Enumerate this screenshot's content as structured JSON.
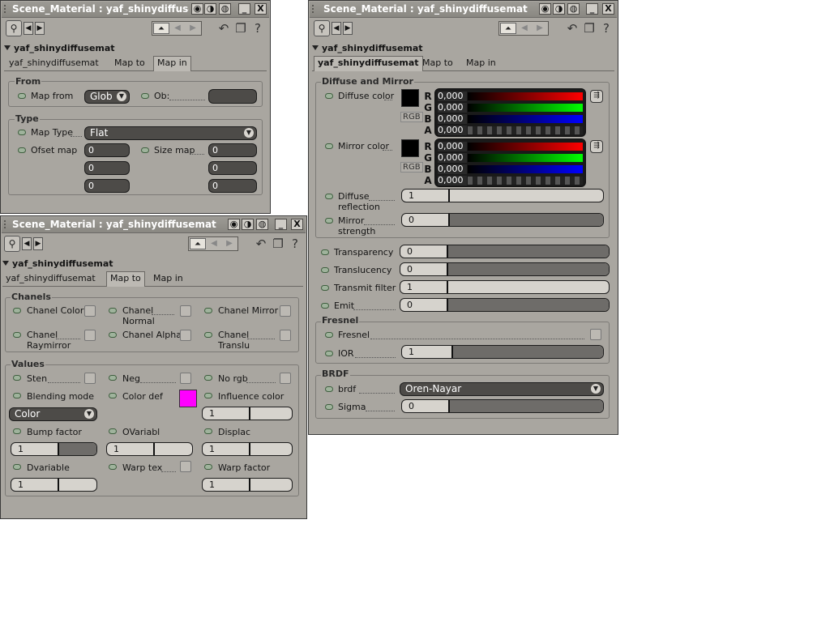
{
  "colors": {
    "accent_magenta": "#ff00ff",
    "window_bg": "#a9a6a0"
  },
  "title_buttons": {
    "min": "_",
    "close": "X"
  },
  "window_a": {
    "title": "Scene_Material : yaf_shinydiffusem...",
    "material": "yaf_shinydiffusemat",
    "tabs": [
      "yaf_shinydiffusemat",
      "Map to",
      "Map in"
    ],
    "active_tab": "Map in",
    "from": {
      "title": "From",
      "map_from_label": "Map from",
      "map_from_value": "Glob",
      "ob_label": "Ob:"
    },
    "type": {
      "title": "Type",
      "map_type_label": "Map Type",
      "map_type_value": "Flat",
      "ofset_label": "Ofset map",
      "size_label": "Size map",
      "ofset_values": [
        "0",
        "0",
        "0"
      ],
      "size_values": [
        "0",
        "0",
        "0"
      ]
    }
  },
  "window_b": {
    "title": "Scene_Material : yaf_shinydiffusemat",
    "material": "yaf_shinydiffusemat",
    "tabs": [
      "yaf_shinydiffusemat",
      "Map to",
      "Map in"
    ],
    "active_tab": "Map to",
    "chanels": {
      "title": "Chanels",
      "items": [
        {
          "label": "Chanel Color",
          "label2": ""
        },
        {
          "label": "Chanel",
          "label2": "Normal"
        },
        {
          "label": "Chanel Mirror",
          "label2": ""
        },
        {
          "label": "Chanel",
          "label2": "Raymirror"
        },
        {
          "label": "Chanel Alpha",
          "label2": ""
        },
        {
          "label": "Chanel",
          "label2": "Translu"
        }
      ]
    },
    "values": {
      "title": "Values",
      "sten": "Sten",
      "neg": "Neg",
      "no_rgb": "No rgb",
      "blending_mode": "Blending mode",
      "color_def": "Color def",
      "influence_color": "Influence color",
      "influence_value": "1",
      "blend_dropdown": "Color",
      "bump_factor": "Bump factor",
      "bump_value": "1",
      "ovariabl": "OVariabl",
      "ovariabl_value": "1",
      "displac": "Displac",
      "displac_value": "1",
      "dvariable": "Dvariable",
      "dvariable_value": "1",
      "warp_tex": "Warp tex",
      "warp_factor": "Warp factor",
      "warp_factor_value": "1"
    }
  },
  "window_c": {
    "title": "Scene_Material : yaf_shinydiffusemat",
    "material": "yaf_shinydiffusemat",
    "tabs": [
      "yaf_shinydiffusemat",
      "Map to",
      "Map in"
    ],
    "active_tab": "yaf_shinydiffusemat",
    "diffuse_mirror": {
      "title": "Diffuse and Mirror",
      "diffuse_color": "Diffuse color",
      "mirror_color": "Mirror color",
      "rgb_tag": "RGB",
      "channel_letters": [
        "R",
        "G",
        "B",
        "A"
      ],
      "diffuse_rgba": [
        "0,000",
        "0,000",
        "0,000",
        "0,000"
      ],
      "mirror_rgba": [
        "0,000",
        "0,000",
        "0,000",
        "0,000"
      ],
      "diffuse_reflection_l1": "Diffuse",
      "diffuse_reflection_l2": "reflection",
      "diffuse_reflection_value": "1",
      "mirror_strength_l1": "Mirror",
      "mirror_strength_l2": "strength",
      "mirror_strength_value": "0"
    },
    "props": [
      {
        "label": "Transparency",
        "value": "0"
      },
      {
        "label": "Translucency",
        "value": "0"
      },
      {
        "label": "Transmit filter",
        "value": "1"
      },
      {
        "label": "Emit",
        "value": "0"
      }
    ],
    "fresnel": {
      "title": "Fresnel",
      "fresnel_label": "Fresnel",
      "ior_label": "IOR",
      "ior_value": "1"
    },
    "brdf": {
      "title": "BRDF",
      "brdf_label": "brdf",
      "brdf_value": "Oren-Nayar",
      "sigma_label": "Sigma",
      "sigma_value": "0"
    }
  }
}
